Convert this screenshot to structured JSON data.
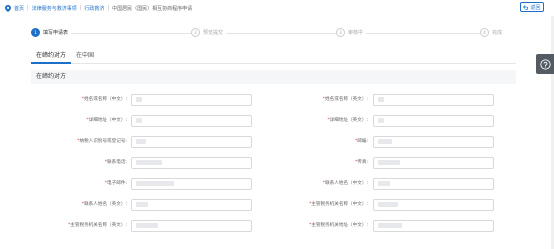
{
  "breadcrumb": {
    "items": [
      {
        "label": "首页"
      },
      {
        "label": "法律服务与救济事项"
      },
      {
        "label": "行政救济"
      },
      {
        "label": "中国居民（国民）相互协商程序申请"
      }
    ]
  },
  "back_button": {
    "label": "返回"
  },
  "steps": [
    {
      "num": "1",
      "label": "填写申请表"
    },
    {
      "num": "2",
      "label": "预览提交"
    },
    {
      "num": "3",
      "label": "审核中"
    },
    {
      "num": "4",
      "label": "完成"
    }
  ],
  "tabs": [
    {
      "label": "在缔约对方"
    },
    {
      "label": "在中国"
    }
  ],
  "section": {
    "title": "在缔约对方"
  },
  "form": {
    "rows": [
      {
        "left": {
          "label": "姓名或名称（中文）"
        },
        "right": {
          "label": "姓名或名称（英文）"
        }
      },
      {
        "left": {
          "label": "详细地址（中文）"
        },
        "right": {
          "label": "详细地址（英文）"
        }
      },
      {
        "left": {
          "label": "纳税人识别号或登记号"
        },
        "right": {
          "label": "邮编"
        }
      },
      {
        "left": {
          "label": "联系电话"
        },
        "right": {
          "label": "传真"
        }
      },
      {
        "left": {
          "label": "电子邮件"
        },
        "right": {
          "label": "联系人姓名（中文）"
        }
      },
      {
        "left": {
          "label": "联系人姓名（英文）"
        },
        "right": {
          "label": "主管税务机关名称（中文）"
        }
      },
      {
        "left": {
          "label": "主管税务机关名称（英文）"
        },
        "right": {
          "label": "主管税务机关地址（中文）"
        }
      }
    ]
  },
  "colors": {
    "accent": "#1e6fc7",
    "required": "#e4393c",
    "section_bg": "#f5f6f8"
  },
  "icons": {
    "location": "location-pin-icon",
    "back": "back-arrow-icon",
    "help": "help-circle-icon"
  }
}
